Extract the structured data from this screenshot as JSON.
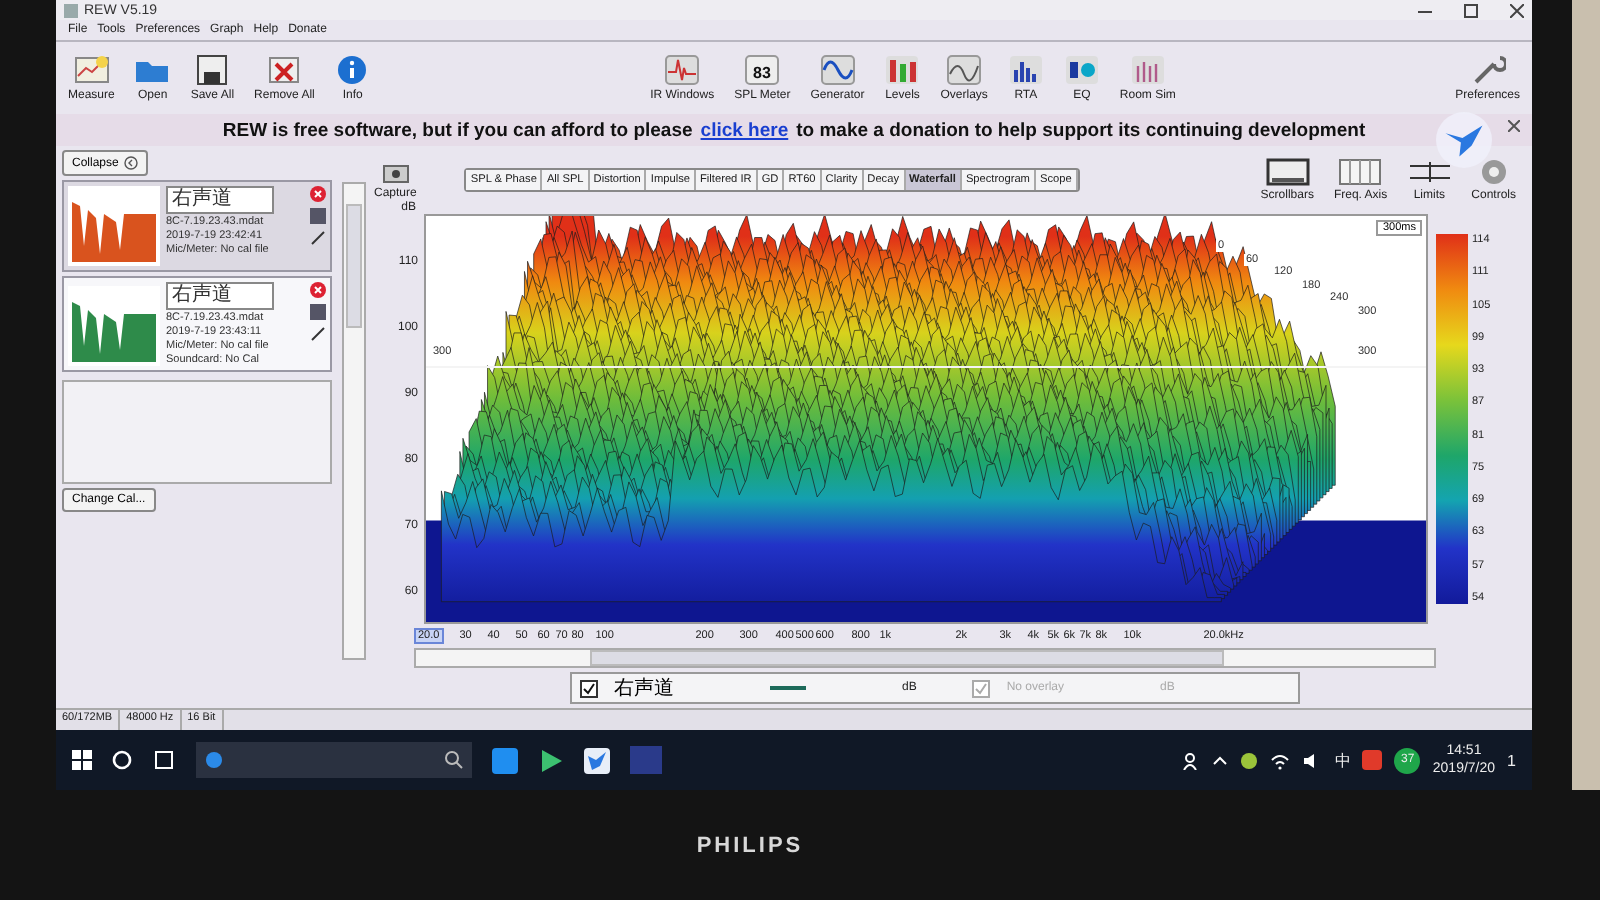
{
  "window": {
    "title": "REW V5.19"
  },
  "menu": [
    "File",
    "Tools",
    "Preferences",
    "Graph",
    "Help",
    "Donate"
  ],
  "toolbar_left": [
    {
      "label": "Measure",
      "kind": "measure"
    },
    {
      "label": "Open",
      "kind": "folder"
    },
    {
      "label": "Save All",
      "kind": "save"
    },
    {
      "label": "Remove All",
      "kind": "remove"
    },
    {
      "label": "Info",
      "kind": "info"
    }
  ],
  "toolbar_center": [
    {
      "label": "IR Windows",
      "kind": "impulse"
    },
    {
      "label": "SPL Meter",
      "kind": "meter",
      "reading": "83"
    },
    {
      "label": "Generator",
      "kind": "sine"
    },
    {
      "label": "Levels",
      "kind": "levels"
    },
    {
      "label": "Overlays",
      "kind": "overlays"
    },
    {
      "label": "RTA",
      "kind": "rta"
    },
    {
      "label": "EQ",
      "kind": "eq"
    },
    {
      "label": "Room Sim",
      "kind": "room"
    }
  ],
  "preferences": {
    "label": "Preferences"
  },
  "banner": {
    "before": "REW is free software, but if you can afford to please",
    "link": "click here",
    "after": "to make a donation to help support its continuing development"
  },
  "sidebar": {
    "collapse": "Collapse",
    "measurements": [
      {
        "name": "右声道",
        "file": "8C-7.19.23.43.mdat",
        "date": "2019-7-19 23:42:41",
        "lines": [
          "Mic/Meter: No cal file"
        ],
        "color": "#d9531e",
        "selected": false
      },
      {
        "name": "右声道",
        "file": "8C-7.19.23.43.mdat",
        "date": "2019-7-19 23:43:11",
        "lines": [
          "Mic/Meter: No cal file",
          "Soundcard: No Cal"
        ],
        "color": "#2e8b4a",
        "selected": true
      }
    ],
    "change_cal": "Change Cal..."
  },
  "graph": {
    "capture": "Capture",
    "tabs": [
      {
        "label": "SPL & Phase",
        "selected": false
      },
      {
        "label": "All SPL",
        "selected": false
      },
      {
        "label": "Distortion",
        "selected": false
      },
      {
        "label": "Impulse",
        "selected": false
      },
      {
        "label": "Filtered IR",
        "selected": false
      },
      {
        "label": "GD",
        "selected": false
      },
      {
        "label": "RT60",
        "selected": false
      },
      {
        "label": "Clarity",
        "selected": false
      },
      {
        "label": "Decay",
        "selected": false
      },
      {
        "label": "Waterfall",
        "selected": true
      },
      {
        "label": "Spectrogram",
        "selected": false
      },
      {
        "label": "Scope",
        "selected": false
      }
    ],
    "view_buttons": [
      {
        "label": "Scrollbars",
        "kind": "scrollbars"
      },
      {
        "label": "Freq. Axis",
        "kind": "axis"
      },
      {
        "label": "Limits",
        "kind": "limits"
      },
      {
        "label": "Controls",
        "kind": "controls"
      }
    ],
    "y_unit": "dB",
    "y_ticks": [
      "110",
      "100",
      "90",
      "80",
      "70",
      "60"
    ],
    "x_start": "20.0",
    "x_ticks": [
      "30",
      "40",
      "50",
      "60",
      "70",
      "80",
      "100",
      "200",
      "300",
      "400",
      "500",
      "600",
      "800",
      "1k",
      "2k",
      "3k",
      "4k",
      "5k",
      "6k",
      "7k",
      "8k",
      "10k"
    ],
    "x_end": "20.0kHz",
    "time_range": "300ms",
    "time_labels": [
      "0",
      "60",
      "120",
      "180",
      "240",
      "300"
    ],
    "level_line": [
      "300",
      "300"
    ],
    "scale_labels": [
      "114",
      "111",
      "105",
      "99",
      "93",
      "87",
      "81",
      "75",
      "69",
      "63",
      "57",
      "54"
    ]
  },
  "legend": [
    {
      "kind": "trace",
      "checked": true,
      "disabled": false,
      "label": "右声道",
      "unit": "dB"
    },
    {
      "kind": "overlay",
      "checked": true,
      "disabled": true,
      "label": "No overlay",
      "unit": "dB"
    }
  ],
  "status_bar": [
    "60/172MB",
    "48000 Hz",
    "16 Bit"
  ],
  "taskbar": {
    "ime": "中",
    "badge": "37",
    "time": "14:51",
    "date": "2019/7/20",
    "notifications": "1"
  },
  "monitor": {
    "brand": "PHILIPS"
  }
}
